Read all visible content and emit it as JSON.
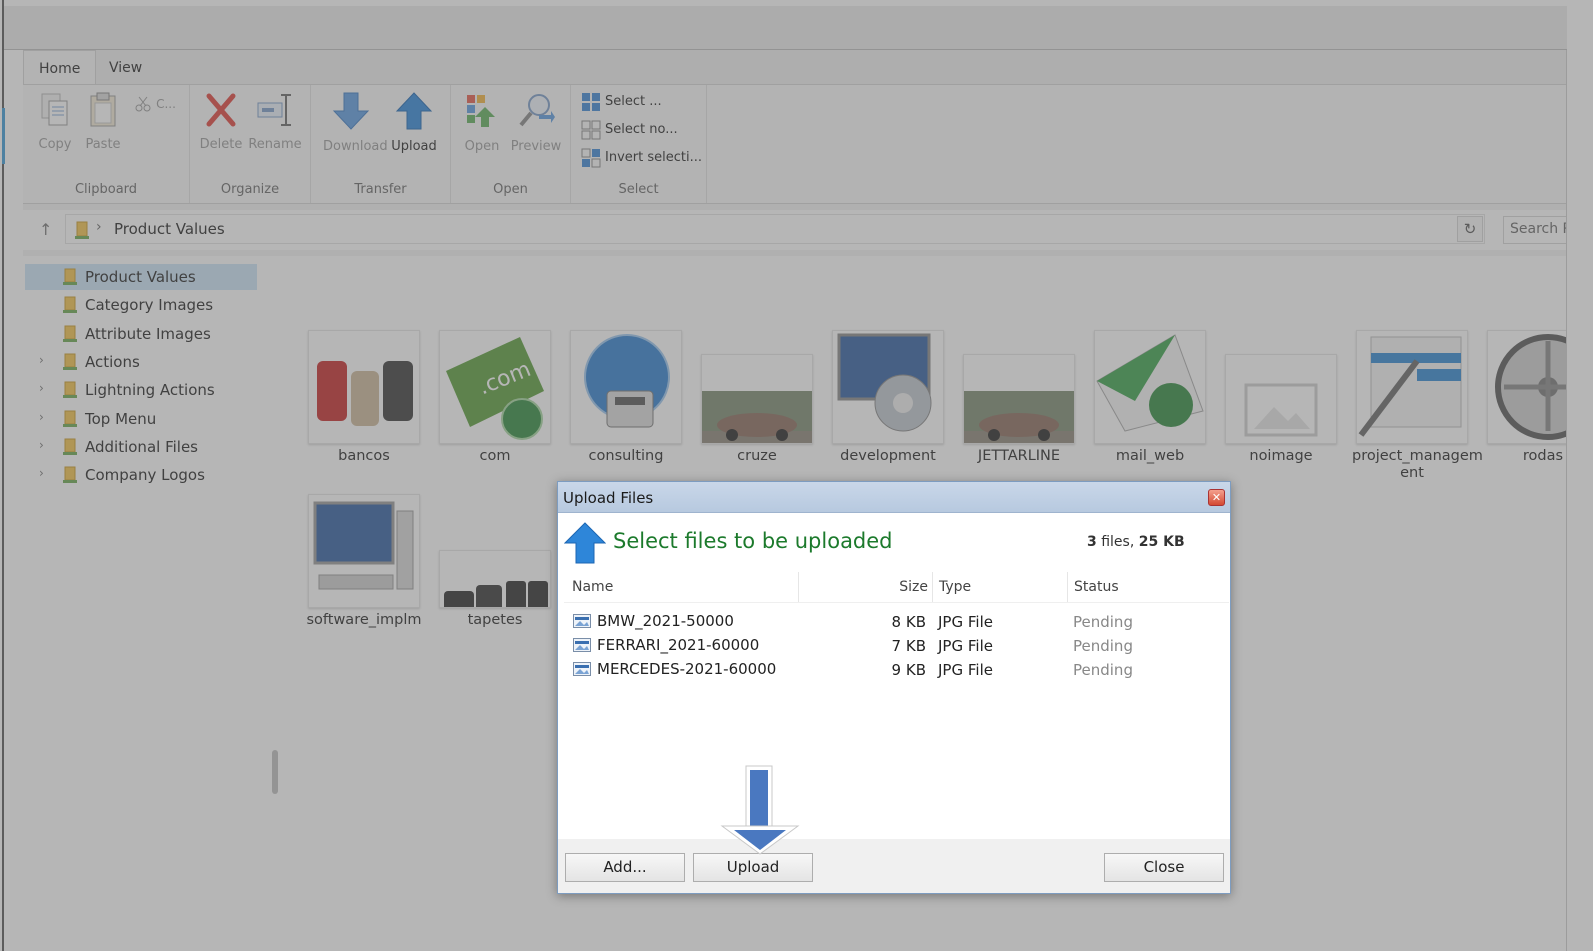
{
  "ribbon": {
    "tabs": [
      {
        "label": "Home"
      },
      {
        "label": "View"
      }
    ],
    "clipboard": {
      "label": "Clipboard",
      "copy": "Copy",
      "paste": "Paste",
      "cut": "C..."
    },
    "organize": {
      "label": "Organize",
      "delete": "Delete",
      "rename": "Rename"
    },
    "transfer": {
      "label": "Transfer",
      "download": "Download",
      "upload": "Upload"
    },
    "open": {
      "label": "Open",
      "open": "Open",
      "preview": "Preview"
    },
    "select": {
      "label": "Select",
      "select_all": "Select ...",
      "select_none": "Select no...",
      "invert": "Invert selecti..."
    }
  },
  "address": {
    "path": "Product Values",
    "search_placeholder": "Search P"
  },
  "tree": {
    "items": [
      {
        "label": "Product Values",
        "expandable": false,
        "selected": true
      },
      {
        "label": "Category Images",
        "expandable": false
      },
      {
        "label": "Attribute Images",
        "expandable": false
      },
      {
        "label": "Actions",
        "expandable": true
      },
      {
        "label": "Lightning Actions",
        "expandable": true
      },
      {
        "label": "Top Menu",
        "expandable": true
      },
      {
        "label": "Additional Files",
        "expandable": true
      },
      {
        "label": "Company Logos",
        "expandable": true
      }
    ]
  },
  "files": {
    "row1": [
      {
        "label": "bancos",
        "icon": "seats-thumbnail"
      },
      {
        "label": "com",
        "icon": "dotcom-thumbnail"
      },
      {
        "label": "consulting",
        "icon": "phone-globe-thumbnail"
      },
      {
        "label": "cruze",
        "icon": "car-photo-thumbnail"
      },
      {
        "label": "development",
        "icon": "monitor-gear-thumbnail"
      },
      {
        "label": "JETTARLINE",
        "icon": "car-photo-thumbnail"
      },
      {
        "label": "mail_web",
        "icon": "mail-globe-thumbnail"
      },
      {
        "label": "noimage",
        "icon": "placeholder-image-thumbnail"
      },
      {
        "label": "project_managem ent",
        "icon": "pen-chart-thumbnail"
      },
      {
        "label": "rodas",
        "icon": "wheel-thumbnail"
      }
    ],
    "row2": [
      {
        "label": "software_implm",
        "icon": "computer-thumbnail"
      },
      {
        "label": "tapetes",
        "icon": "floor-mats-thumbnail"
      }
    ]
  },
  "dialog": {
    "title": "Upload Files",
    "heading": "Select files to be uploaded",
    "summary": {
      "count": "3",
      "files_word": "files,",
      "size": "25 KB"
    },
    "columns": {
      "name": "Name",
      "size": "Size",
      "type": "Type",
      "status": "Status"
    },
    "rows": [
      {
        "name": "BMW_2021-50000",
        "size": "8 KB",
        "type": "JPG File",
        "status": "Pending"
      },
      {
        "name": "FERRARI_2021-60000",
        "size": "7 KB",
        "type": "JPG File",
        "status": "Pending"
      },
      {
        "name": "MERCEDES-2021-60000",
        "size": "9 KB",
        "type": "JPG File",
        "status": "Pending"
      }
    ],
    "buttons": {
      "add": "Add...",
      "upload": "Upload",
      "close": "Close"
    }
  },
  "colors": {
    "accent": "#3b87d6",
    "heading_green": "#1c7a2c",
    "selection": "#cce4f7"
  }
}
